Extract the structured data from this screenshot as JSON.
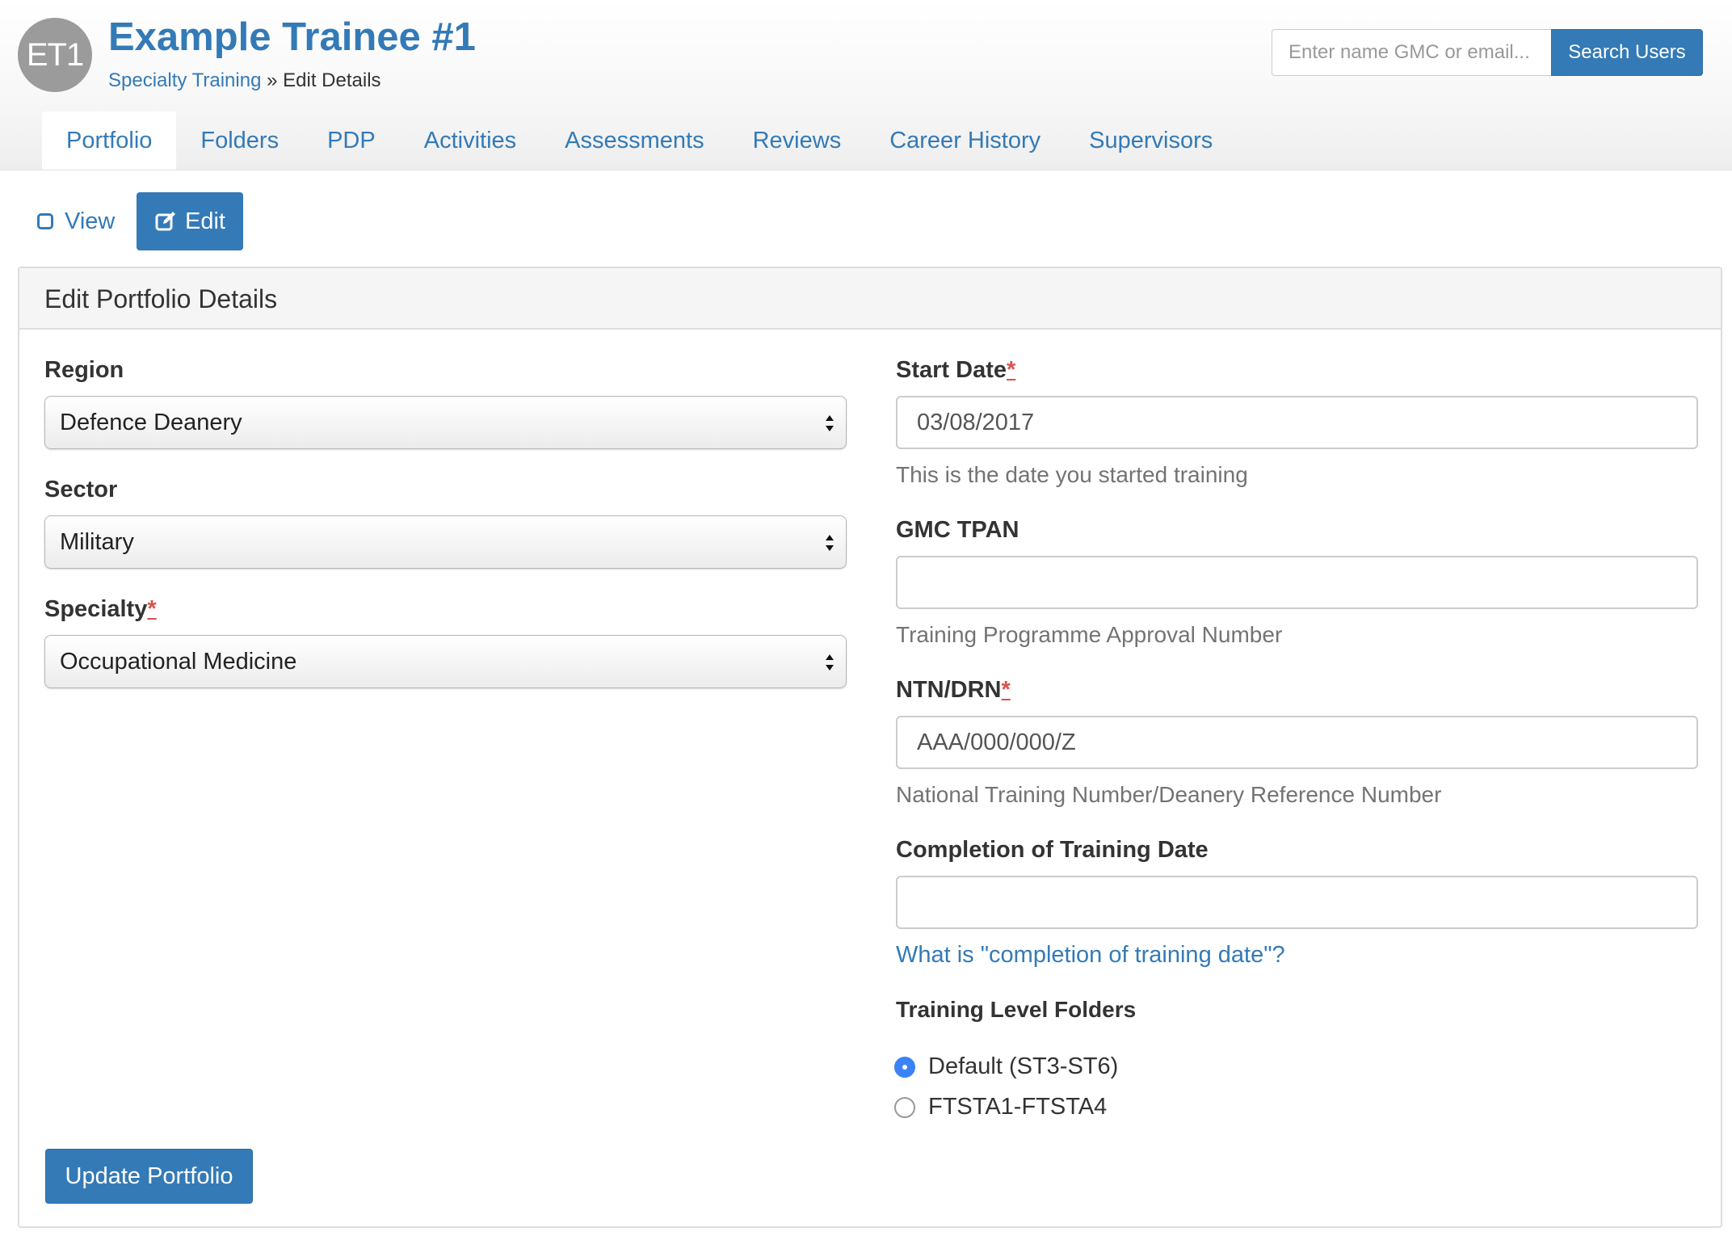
{
  "user": {
    "initials": "ET1",
    "name": "Example Trainee #1"
  },
  "breadcrumb": {
    "parent": "Specialty Training",
    "separator": "»",
    "current": "Edit Details"
  },
  "search": {
    "placeholder": "Enter name GMC or email...",
    "button_label": "Search Users"
  },
  "tabs": [
    {
      "label": "Portfolio",
      "active": true
    },
    {
      "label": "Folders"
    },
    {
      "label": "PDP"
    },
    {
      "label": "Activities"
    },
    {
      "label": "Assessments"
    },
    {
      "label": "Reviews"
    },
    {
      "label": "Career History"
    },
    {
      "label": "Supervisors"
    }
  ],
  "mode": {
    "view_label": "View",
    "edit_label": "Edit"
  },
  "panel": {
    "title": "Edit Portfolio Details"
  },
  "form": {
    "region": {
      "label": "Region",
      "value": "Defence Deanery"
    },
    "sector": {
      "label": "Sector",
      "value": "Military"
    },
    "specialty": {
      "label": "Specialty",
      "required_marker": "*",
      "value": "Occupational Medicine"
    },
    "start_date": {
      "label": "Start Date",
      "required_marker": "*",
      "value": "03/08/2017",
      "help": "This is the date you started training"
    },
    "gmc_tpan": {
      "label": "GMC TPAN",
      "value": "",
      "help": "Training Programme Approval Number"
    },
    "ntn_drn": {
      "label": "NTN/DRN",
      "required_marker": "*",
      "value": "AAA/000/000/Z",
      "help": "National Training Number/Deanery Reference Number"
    },
    "completion_date": {
      "label": "Completion of Training Date",
      "value": "",
      "help_link": "What is \"completion of training date\"?"
    },
    "training_level_folders": {
      "label": "Training Level Folders",
      "options": [
        {
          "label": "Default (ST3-ST6)",
          "checked": true
        },
        {
          "label": "FTSTA1-FTSTA4",
          "checked": false
        }
      ]
    },
    "submit_label": "Update Portfolio"
  },
  "colors": {
    "primary": "#337ab7",
    "required": "#d9534f",
    "radio_selected": "#3b82f6"
  }
}
